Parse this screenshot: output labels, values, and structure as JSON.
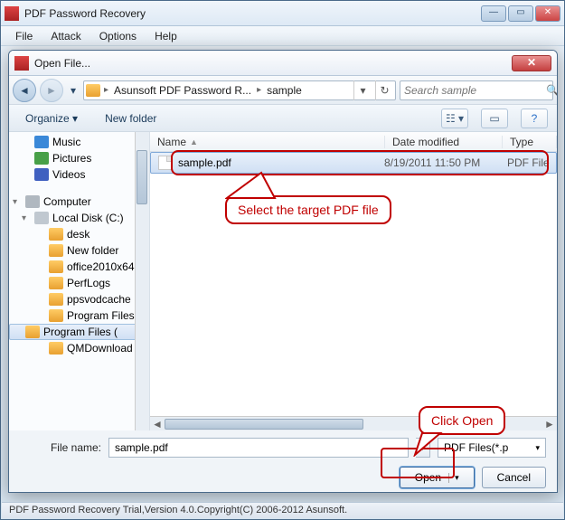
{
  "app": {
    "title": "PDF Password Recovery",
    "menu": [
      "File",
      "Attack",
      "Options",
      "Help"
    ]
  },
  "dialog": {
    "title": "Open File...",
    "breadcrumb": {
      "seg1": "Asunsoft PDF Password R...",
      "seg2": "sample"
    },
    "search_placeholder": "Search sample",
    "toolbar": {
      "organize": "Organize",
      "newfolder": "New folder"
    },
    "tree": [
      {
        "label": "Music",
        "ico": "music",
        "indent": 1
      },
      {
        "label": "Pictures",
        "ico": "pic",
        "indent": 1
      },
      {
        "label": "Videos",
        "ico": "vid",
        "indent": 1
      },
      {
        "label": "",
        "ico": "",
        "indent": 0,
        "blank": true
      },
      {
        "label": "Computer",
        "ico": "comp",
        "indent": 0,
        "exp": "▾"
      },
      {
        "label": "Local Disk (C:)",
        "ico": "disk",
        "indent": 1,
        "exp": "▾"
      },
      {
        "label": "desk",
        "ico": "folder",
        "indent": 2
      },
      {
        "label": "New folder",
        "ico": "folder",
        "indent": 2
      },
      {
        "label": "office2010x64",
        "ico": "folder",
        "indent": 2
      },
      {
        "label": "PerfLogs",
        "ico": "folder",
        "indent": 2
      },
      {
        "label": "ppsvodcache",
        "ico": "folder",
        "indent": 2
      },
      {
        "label": "Program Files",
        "ico": "folder",
        "indent": 2
      },
      {
        "label": "Program Files (",
        "ico": "folder",
        "indent": 2,
        "sel": true
      },
      {
        "label": "QMDownload",
        "ico": "folder",
        "indent": 2
      }
    ],
    "cols": {
      "name": "Name",
      "date": "Date modified",
      "type": "Type"
    },
    "files": [
      {
        "name": "sample.pdf",
        "date": "8/19/2011 11:50 PM",
        "type": "PDF File",
        "sel": true
      }
    ],
    "filename_label": "File name:",
    "filename_value": "sample.pdf",
    "filter": "PDF Files(*.p",
    "open": "Open",
    "cancel": "Cancel"
  },
  "annotations": {
    "a1": "Select the target PDF file",
    "a2": "Click Open"
  },
  "status": "PDF Password Recovery Trial,Version 4.0.Copyright(C) 2006-2012 Asunsoft."
}
